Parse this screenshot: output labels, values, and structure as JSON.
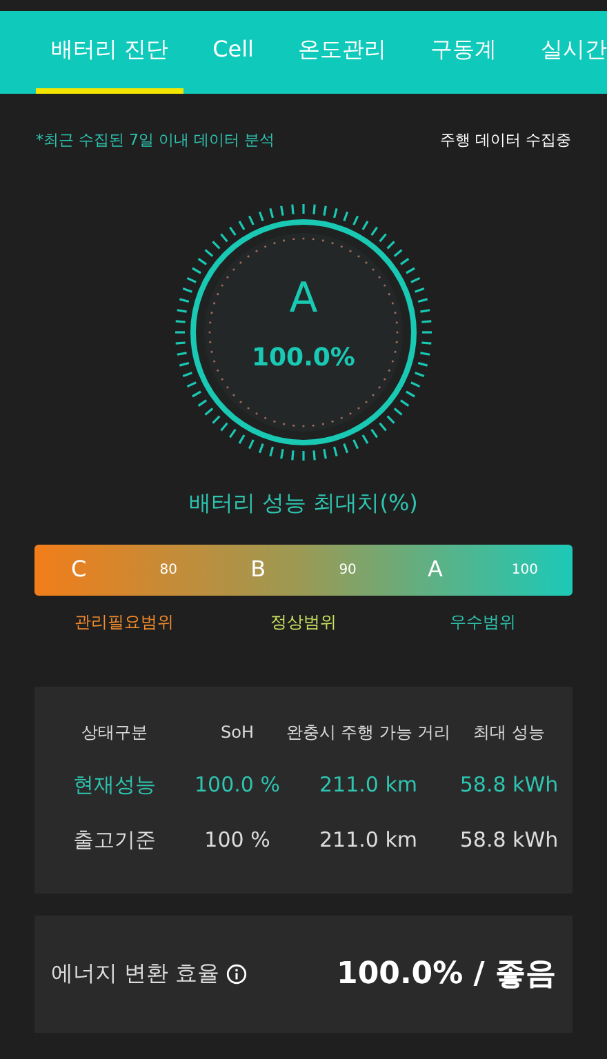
{
  "tabs": [
    {
      "label": "배터리 진단",
      "selected": true
    },
    {
      "label": "Cell",
      "selected": false
    },
    {
      "label": "온도관리",
      "selected": false
    },
    {
      "label": "구동계",
      "selected": false
    },
    {
      "label": "실시간",
      "selected": false
    }
  ],
  "notice": "*최근 수집된 7일 이내 데이터 분석",
  "status": "주행 데이터 수집중",
  "gauge": {
    "grade": "A",
    "percent": "100.0%",
    "caption": "배터리 성능 최대치(%)"
  },
  "grade_scale": [
    {
      "letter": "C",
      "mark": "80",
      "label": "관리필요범위",
      "color": "#f08a2c"
    },
    {
      "letter": "B",
      "mark": "90",
      "label": "정상범위",
      "color": "#c8e060"
    },
    {
      "letter": "A",
      "mark": "100",
      "label": "우수범위",
      "color": "#2ec4b0"
    }
  ],
  "table": {
    "columns": [
      "상태구분",
      "SoH",
      "완충시 주행 가능 거리",
      "최대 성능"
    ],
    "rows": [
      {
        "cells": [
          "현재성능",
          "100.0 %",
          "211.0 km",
          "58.8 kWh"
        ],
        "highlighted": true
      },
      {
        "cells": [
          "출고기준",
          "100 %",
          "211.0 km",
          "58.8 kWh"
        ],
        "highlighted": false
      }
    ]
  },
  "efficiency": {
    "label": "에너지 변환 효율",
    "value": "100.0% / 좋음"
  }
}
